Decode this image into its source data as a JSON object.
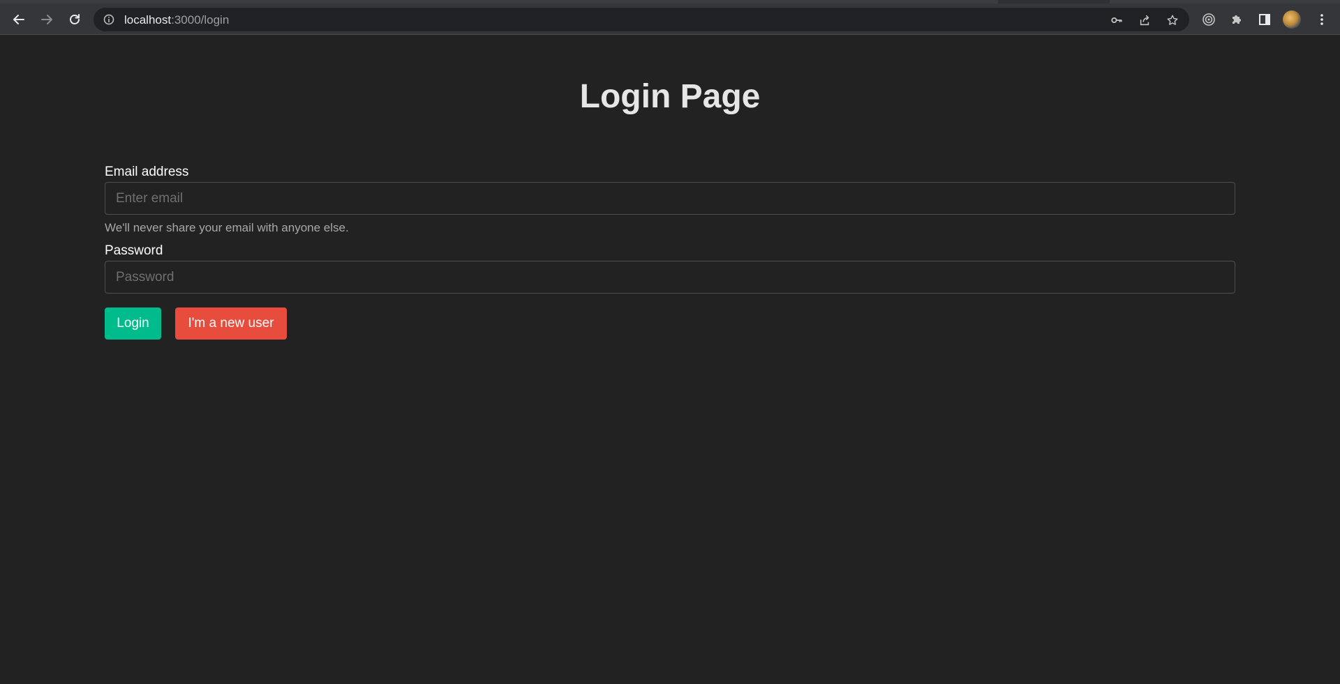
{
  "browser": {
    "url_host": "localhost",
    "url_rest": ":3000/login",
    "icons": {
      "back": "back-arrow-icon",
      "forward": "forward-arrow-icon",
      "reload": "reload-icon",
      "info": "info-icon",
      "password": "key-icon",
      "share": "share-icon",
      "bookmark": "star-icon",
      "extension1": "target-icon",
      "extensions": "puzzle-icon",
      "side_panel": "side-panel-icon",
      "menu": "kebab-menu-icon"
    }
  },
  "page": {
    "title": "Login Page"
  },
  "form": {
    "email_label": "Email address",
    "email_placeholder": "Enter email",
    "email_value": "",
    "email_help": "We'll never share your email with anyone else.",
    "password_label": "Password",
    "password_placeholder": "Password",
    "password_value": ""
  },
  "buttons": {
    "login_label": "Login",
    "new_user_label": "I'm a new user"
  },
  "colors": {
    "background": "#222222",
    "login_button": "#00bc8c",
    "new_user_button": "#e74c3c"
  }
}
